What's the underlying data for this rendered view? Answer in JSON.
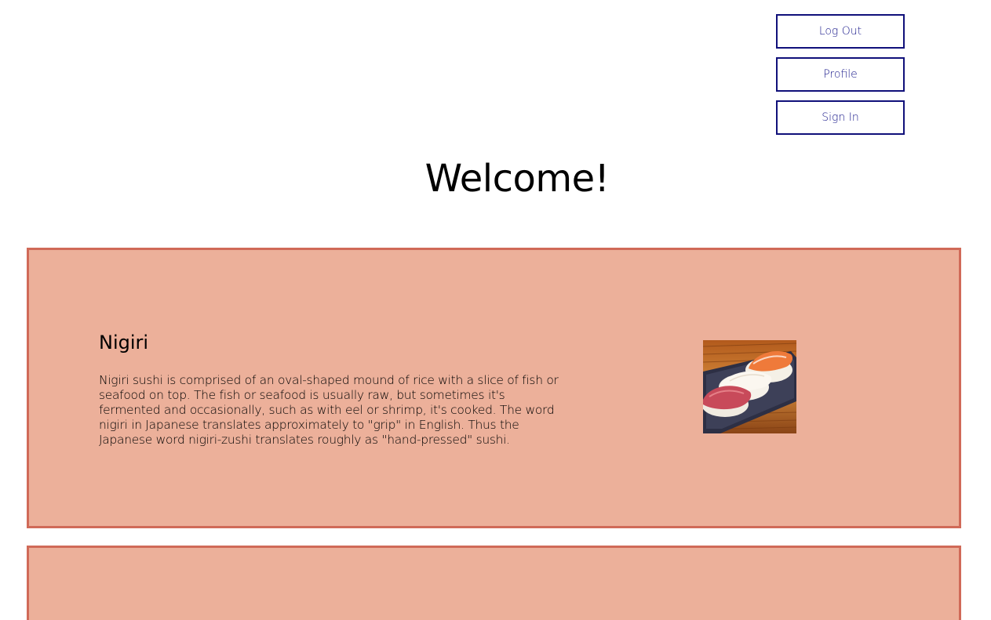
{
  "nav": {
    "logout_label": "Log Out",
    "profile_label": "Profile",
    "signin_label": "Sign In"
  },
  "main": {
    "heading": "Welcome!",
    "cards": [
      {
        "title": "Nigiri",
        "description": "Nigiri sushi is comprised of an oval-shaped mound of rice with a slice of fish or seafood on top. The fish or seafood is usually raw, but sometimes it's fermented and occasionally, such as with eel or shrimp, it's cooked. The word nigiri in Japanese translates approximately to \"grip\" in English. Thus the Japanese word nigiri-zushi translates roughly as \"hand-pressed\" sushi.",
        "image": "nigiri-sushi-photo"
      },
      {
        "title": "",
        "description": ""
      }
    ]
  },
  "colors": {
    "button_border": "#10107a",
    "button_text": "#1c1c8c",
    "card_background": "#ecb09a",
    "card_border": "#d06a58"
  }
}
